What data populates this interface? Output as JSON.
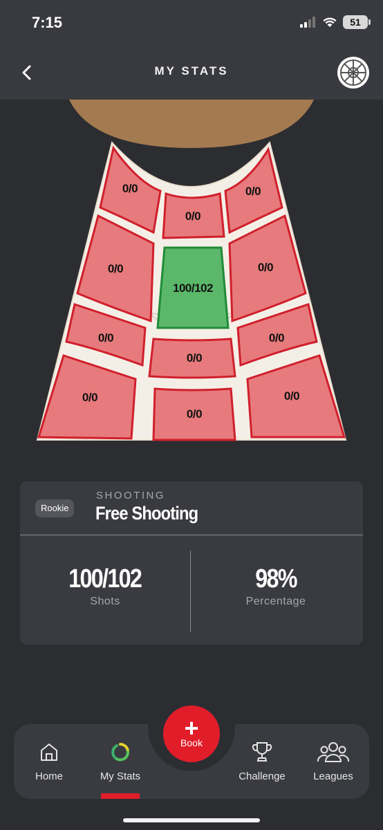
{
  "status_bar": {
    "time": "7:15",
    "battery": "51"
  },
  "header": {
    "title": "MY STATS"
  },
  "court": {
    "zones": [
      {
        "id": "left-corner-upper",
        "label": "0/0"
      },
      {
        "id": "top-center",
        "label": "0/0"
      },
      {
        "id": "right-corner-upper",
        "label": "0/0"
      },
      {
        "id": "left-wing-mid",
        "label": "0/0"
      },
      {
        "id": "paint",
        "label": "100/102"
      },
      {
        "id": "right-wing-mid",
        "label": "0/0"
      },
      {
        "id": "left-wing-low",
        "label": "0/0"
      },
      {
        "id": "center-low",
        "label": "0/0"
      },
      {
        "id": "right-wing-low",
        "label": "0/0"
      },
      {
        "id": "left-bottom",
        "label": "0/0"
      },
      {
        "id": "center-bottom",
        "label": "0/0"
      },
      {
        "id": "right-bottom",
        "label": "0/0"
      }
    ],
    "colors": {
      "empty_zone": "#e77a7c",
      "active_zone": "#5bb86a",
      "zone_border": "#d01f2c",
      "active_border": "#1f8a38"
    }
  },
  "card": {
    "level": "Rookie",
    "category": "SHOOTING",
    "session": "Free Shooting",
    "shots_value": "100/102",
    "shots_label": "Shots",
    "percentage_value": "98%",
    "percentage_label": "Percentage"
  },
  "nav": {
    "home": "Home",
    "my_stats": "My Stats",
    "book": "Book",
    "challenge": "Challenge",
    "leagues": "Leagues",
    "active": "my_stats"
  },
  "colors": {
    "accent": "#e11d2a",
    "background": "#2c2d31",
    "surface": "#3a3b40"
  }
}
